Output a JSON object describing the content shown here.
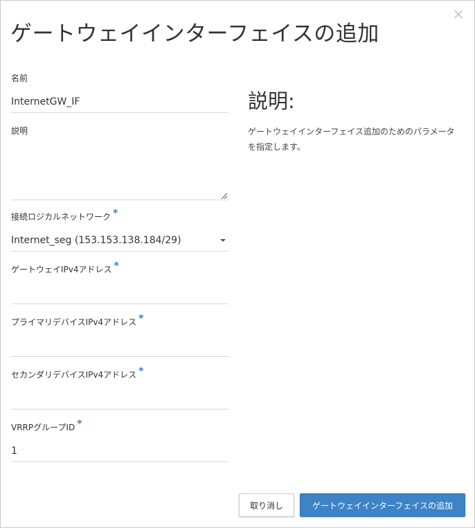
{
  "modal": {
    "title": "ゲートウェイインターフェイスの追加",
    "close_glyph": "×"
  },
  "form": {
    "name": {
      "label": "名前",
      "value": "InternetGW_IF"
    },
    "description": {
      "label": "説明",
      "value": ""
    },
    "logical_network": {
      "label": "接続ロジカルネットワーク",
      "required": "*",
      "selected": "Internet_seg (153.153.138.184/29)"
    },
    "gateway_ipv4": {
      "label": "ゲートウェイIPv4アドレス",
      "required": "*",
      "value": ""
    },
    "primary_ipv4": {
      "label": "プライマリデバイスIPv4アドレス",
      "required": "*",
      "value": ""
    },
    "secondary_ipv4": {
      "label": "セカンダリデバイスIPv4アドレス",
      "required": "*",
      "value": ""
    },
    "vrrp_group_id": {
      "label": "VRRPグループID",
      "required": "*",
      "value": "1"
    }
  },
  "help": {
    "title": "説明:",
    "text": "ゲートウェイインターフェイス追加のためのパラメータを指定します。"
  },
  "footer": {
    "cancel_label": "取り消し",
    "submit_label": "ゲートウェイインターフェイスの追加"
  },
  "colors": {
    "primary": "#3d83c6",
    "required": "#3a7ec6",
    "close": "#c4c4c4"
  },
  "icons": {
    "close": "close-icon",
    "dropdown": "caret-down-icon",
    "resize": "resize-handle-icon"
  }
}
